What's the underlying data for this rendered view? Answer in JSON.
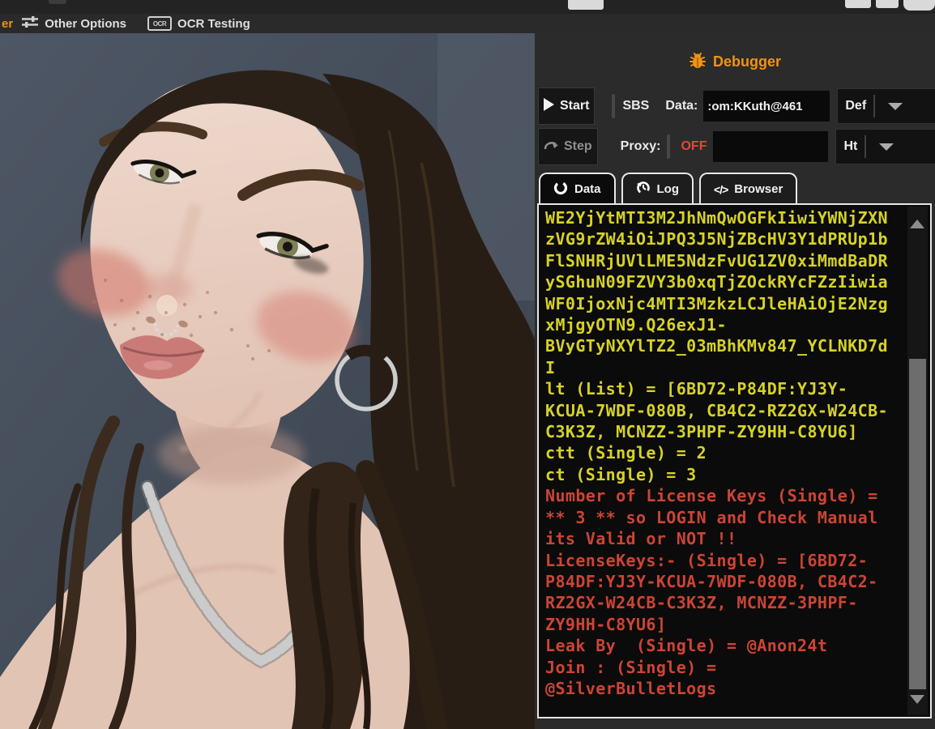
{
  "menubar": {
    "clipped_item": "er",
    "items": [
      {
        "label": "Other Options",
        "icon": "sliders-icon"
      },
      {
        "label": "OCR Testing",
        "icon": "ocr-icon",
        "icon_text": "OCR"
      }
    ]
  },
  "debugger": {
    "title": "Debugger",
    "start_button": "Start",
    "step_button": "Step",
    "sbs_label": "SBS",
    "data_label": "Data:",
    "data_value": ":om:KKuth@461",
    "wordlist_type_value": "Def",
    "proxy_label": "Proxy:",
    "proxy_off": "OFF",
    "proxy_value": "",
    "proxy_type_value": "Ht",
    "tabs": [
      {
        "label": "Data",
        "icon": "data-circle-icon",
        "active": true
      },
      {
        "label": "Log",
        "icon": "log-history-icon",
        "active": false
      },
      {
        "label": "Browser",
        "icon": "browser-code-icon",
        "active": false,
        "icon_text": "</>"
      }
    ],
    "console_lines": [
      {
        "text": "WE2YjYtMTI3M2JhNmQwOGFkIiwiYWNjZXN",
        "type": "token"
      },
      {
        "text": "zVG9rZW4iOiJPQ3J5NjZBcHV3Y1dPRUp1b",
        "type": "token"
      },
      {
        "text": "FlSNHRjUVlLME5NdzFvUG1ZV0xiMmdBaDR",
        "type": "token"
      },
      {
        "text": "ySGhuN09FZVY3b0xqTjZOckRYcFZzIiwia",
        "type": "token"
      },
      {
        "text": "WF0IjoxNjc4MTI3MzkzLCJleHAiOjE2Nzg",
        "type": "token"
      },
      {
        "text": "xMjgyOTN9.Q26exJ1-",
        "type": "token"
      },
      {
        "text": "BVyGTyNXYlTZ2_03mBhKMv847_YCLNKD7d",
        "type": "token"
      },
      {
        "text": "I",
        "type": "token"
      },
      {
        "text": "lt (List) = [6BD72-P84DF:YJ3Y-",
        "type": "token"
      },
      {
        "text": "KCUA-7WDF-080B, CB4C2-RZ2GX-W24CB-",
        "type": "token"
      },
      {
        "text": "C3K3Z, MCNZZ-3PHPF-ZY9HH-C8YU6]",
        "type": "token"
      },
      {
        "text": "ctt (Single) = 2",
        "type": "token"
      },
      {
        "text": "ct (Single) = 3",
        "type": "token"
      },
      {
        "text": "Number of License Keys (Single) =",
        "type": "alert"
      },
      {
        "text": "** 3 ** so LOGIN and Check Manual",
        "type": "alert"
      },
      {
        "text": "its Valid or NOT !!",
        "type": "alert"
      },
      {
        "text": "LicenseKeys:- (Single) = [6BD72-",
        "type": "alert"
      },
      {
        "text": "P84DF:YJ3Y-KCUA-7WDF-080B, CB4C2-",
        "type": "alert"
      },
      {
        "text": "RZ2GX-W24CB-C3K3Z, MCNZZ-3PHPF-",
        "type": "alert"
      },
      {
        "text": "ZY9HH-C8YU6]",
        "type": "alert"
      },
      {
        "text": "Leak By  (Single) = @Anon24t",
        "type": "alert"
      },
      {
        "text": "Join : (Single) =",
        "type": "alert"
      },
      {
        "text": "@SilverBulletLogs",
        "type": "alert"
      }
    ]
  },
  "colors": {
    "accent": "#ef9414",
    "token": "#d6d226",
    "alert": "#cd4434",
    "off": "#e2483d"
  }
}
